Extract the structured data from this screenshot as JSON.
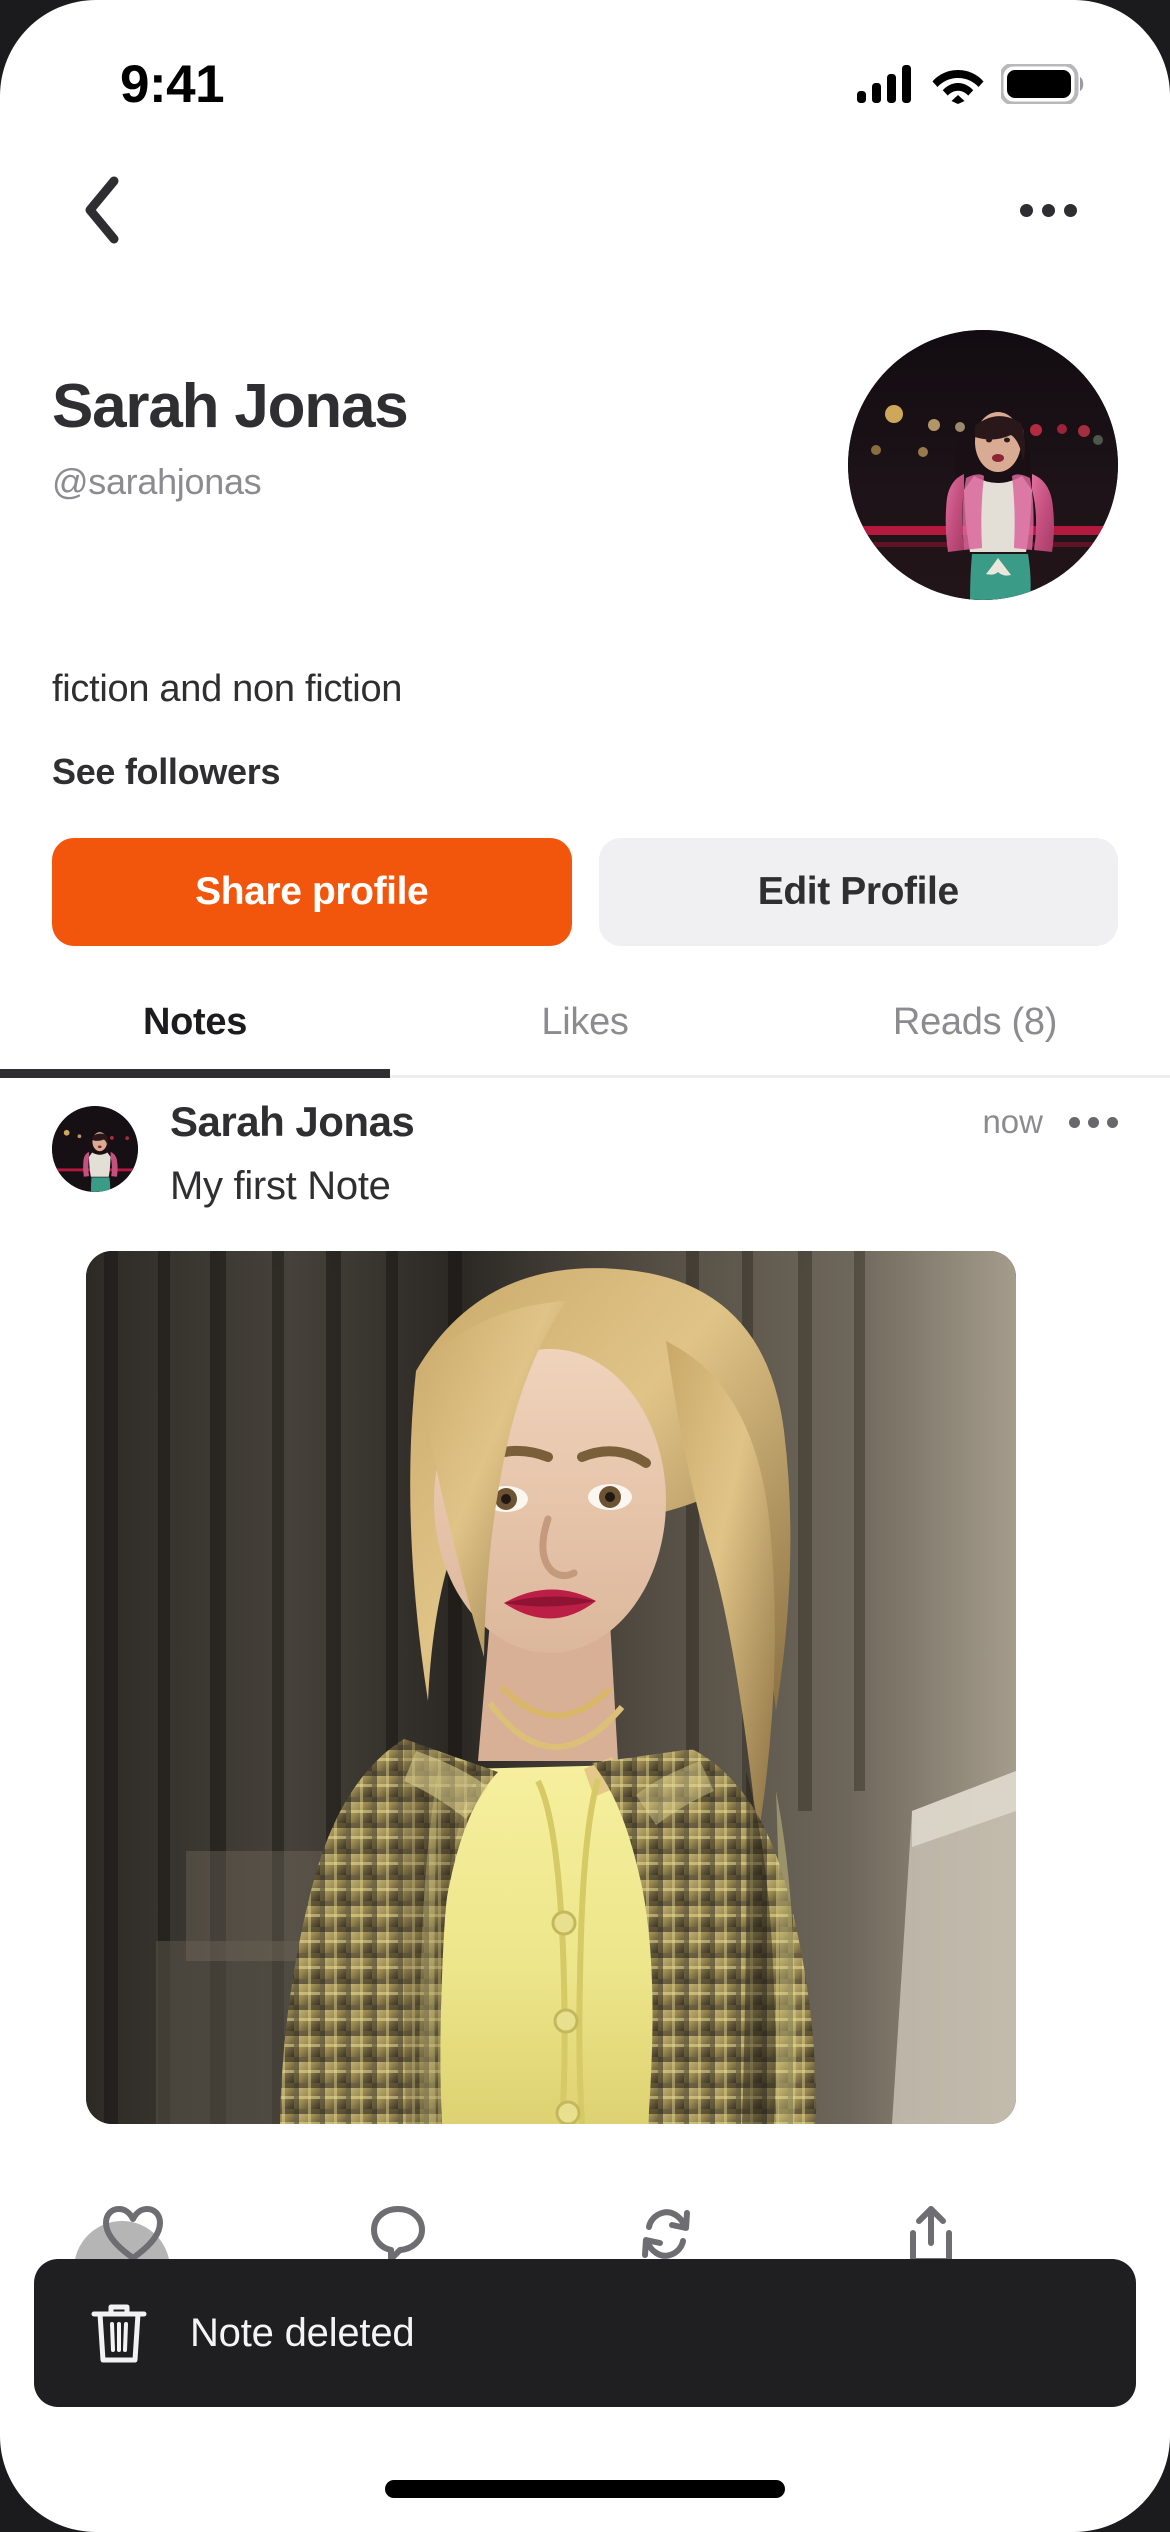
{
  "status_bar": {
    "time": "9:41",
    "cellular_icon": "cellular-signal-icon",
    "wifi_icon": "wifi-icon",
    "battery_icon": "battery-full-icon"
  },
  "nav": {
    "back_icon": "chevron-left-icon",
    "more_icon": "more-horizontal-icon"
  },
  "profile": {
    "name": "Sarah Jonas",
    "handle": "@sarahjonas",
    "bio": "fiction and non fiction",
    "followers_link": "See followers",
    "avatar_alt": "avatar-sarah-jonas",
    "share_button": "Share profile",
    "edit_button": "Edit Profile"
  },
  "tabs": [
    {
      "label": "Notes",
      "active": true
    },
    {
      "label": "Likes",
      "active": false
    },
    {
      "label": "Reads (8)",
      "active": false
    }
  ],
  "note": {
    "author": "Sarah Jonas",
    "timestamp": "now",
    "text": "My first Note",
    "more_icon": "more-horizontal-icon",
    "image_alt": "note-photo-yellow-plaid-outfit",
    "actions": [
      {
        "name": "like",
        "icon": "heart-icon"
      },
      {
        "name": "comment",
        "icon": "comment-bubble-icon"
      },
      {
        "name": "repost",
        "icon": "repost-icon"
      },
      {
        "name": "share",
        "icon": "share-up-arrow-icon"
      }
    ]
  },
  "toast": {
    "icon": "trash-icon",
    "message": "Note deleted"
  },
  "colors": {
    "accent": "#f2560c",
    "secondary_button": "#f0eff1",
    "text_primary": "#2f2f31",
    "text_muted": "#8c8c90",
    "toast_background": "#1f1f21"
  }
}
